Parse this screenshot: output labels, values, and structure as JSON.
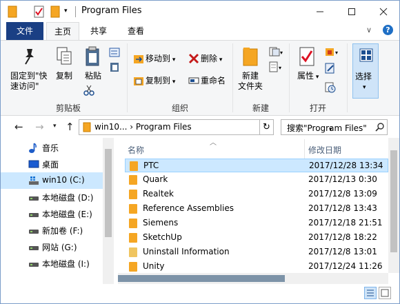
{
  "window": {
    "title": "Program Files"
  },
  "ribbon_tabs": {
    "file": "文件",
    "home": "主页",
    "share": "共享",
    "view": "查看"
  },
  "ribbon": {
    "pin_label_line1": "固定到\"快",
    "pin_label_line2": "速访问\"",
    "copy": "复制",
    "paste": "粘贴",
    "clipboard_group": "剪贴板",
    "move_to": "移动到",
    "copy_to": "复制到",
    "delete": "删除",
    "rename": "重命名",
    "organize_group": "组织",
    "new_folder_line1": "新建",
    "new_folder_line2": "文件夹",
    "new_group": "新建",
    "properties": "属性",
    "open_group": "打开",
    "select": "选择"
  },
  "address": {
    "path": "win10... › Program Files",
    "search_placeholder": "搜索\"Program Files\""
  },
  "nav_pane": {
    "items": [
      {
        "label": "音乐",
        "icon": "music-icon"
      },
      {
        "label": "桌面",
        "icon": "desktop-icon"
      },
      {
        "label": "win10 (C:)",
        "icon": "drive-icon"
      },
      {
        "label": "本地磁盘 (D:)",
        "icon": "drive-icon"
      },
      {
        "label": "本地磁盘 (E:)",
        "icon": "drive-icon"
      },
      {
        "label": "新加卷 (F:)",
        "icon": "drive-icon"
      },
      {
        "label": "网站 (G:)",
        "icon": "drive-icon"
      },
      {
        "label": "本地磁盘 (I:)",
        "icon": "drive-icon"
      }
    ]
  },
  "file_list": {
    "col_name": "名称",
    "col_date": "修改日期",
    "rows": [
      {
        "name": "PTC",
        "date": "2017/12/28 13:34"
      },
      {
        "name": "Quark",
        "date": "2017/12/13 0:30"
      },
      {
        "name": "Realtek",
        "date": "2017/12/8 13:09"
      },
      {
        "name": "Reference Assemblies",
        "date": "2017/12/8 13:43"
      },
      {
        "name": "Siemens",
        "date": "2017/12/18 21:51"
      },
      {
        "name": "SketchUp",
        "date": "2017/12/8 18:22"
      },
      {
        "name": "Uninstall Information",
        "date": "2017/12/8 13:01"
      },
      {
        "name": "Unity",
        "date": "2017/12/24 11:26"
      }
    ]
  },
  "colors": {
    "accent": "#1a3f84",
    "selection": "#cce8ff",
    "folder": "#f5a623"
  }
}
